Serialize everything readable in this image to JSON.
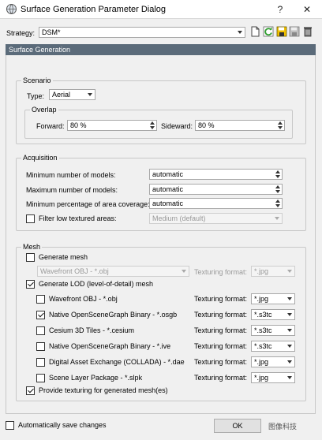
{
  "window": {
    "title": "Surface Generation Parameter Dialog",
    "help_glyph": "?",
    "close_glyph": "✕"
  },
  "strategy": {
    "label": "Strategy:",
    "value": "DSM*"
  },
  "section_header": "Surface Generation",
  "scenario": {
    "title": "Scenario",
    "type_label": "Type:",
    "type_value": "Aerial",
    "overlap": {
      "title": "Overlap",
      "forward_label": "Forward:",
      "forward_value": "80 %",
      "sideward_label": "Sideward:",
      "sideward_value": "80 %"
    }
  },
  "acquisition": {
    "title": "Acquisition",
    "min_models_label": "Minimum number of models:",
    "min_models_value": "automatic",
    "max_models_label": "Maximum number of models:",
    "max_models_value": "automatic",
    "min_coverage_label": "Minimum percentage of area coverage:",
    "min_coverage_value": "automatic",
    "filter_label": "Filter low textured areas:",
    "filter_checked": false,
    "filter_value": "Medium (default)"
  },
  "mesh": {
    "title": "Mesh",
    "generate_mesh_label": "Generate mesh",
    "generate_mesh_checked": false,
    "mesh_format_value": "Wavefront OBJ - *.obj",
    "mesh_texturing_label": "Texturing format:",
    "mesh_texturing_value": "*.jpg",
    "generate_lod_label": "Generate LOD (level-of-detail) mesh",
    "generate_lod_checked": true,
    "lod_formats": [
      {
        "label": "Wavefront OBJ - *.obj",
        "checked": false,
        "texturing_label": "Texturing format:",
        "texturing_value": "*.jpg"
      },
      {
        "label": "Native OpenSceneGraph Binary - *.osgb",
        "checked": true,
        "texturing_label": "Texturing format:",
        "texturing_value": "*.s3tc"
      },
      {
        "label": "Cesium 3D Tiles - *.cesium",
        "checked": false,
        "texturing_label": "Texturing format:",
        "texturing_value": "*.s3tc"
      },
      {
        "label": "Native OpenSceneGraph Binary - *.ive",
        "checked": false,
        "texturing_label": "Texturing format:",
        "texturing_value": "*.s3tc"
      },
      {
        "label": "Digital Asset Exchange (COLLADA) - *.dae",
        "checked": false,
        "texturing_label": "Texturing format:",
        "texturing_value": "*.jpg"
      },
      {
        "label": "Scene Layer Package - *.slpk",
        "checked": false,
        "texturing_label": "Texturing format:",
        "texturing_value": "*.jpg"
      }
    ],
    "provide_texturing_label": "Provide texturing for generated mesh(es)",
    "provide_texturing_checked": true
  },
  "footer": {
    "auto_save_label": "Automatically save changes",
    "auto_save_checked": false,
    "ok_label": "OK",
    "watermark_text": "图像科技"
  },
  "colors": {
    "section_header_bg": "#5b6b7a",
    "window_bg": "#f0f0f0",
    "save_icon": "#f2c200",
    "refresh_icon": "#2f9e2f",
    "delete_icon": "#555555"
  },
  "icons": [
    "new-document-icon",
    "refresh-icon",
    "save-icon",
    "save-as-icon",
    "delete-icon"
  ]
}
